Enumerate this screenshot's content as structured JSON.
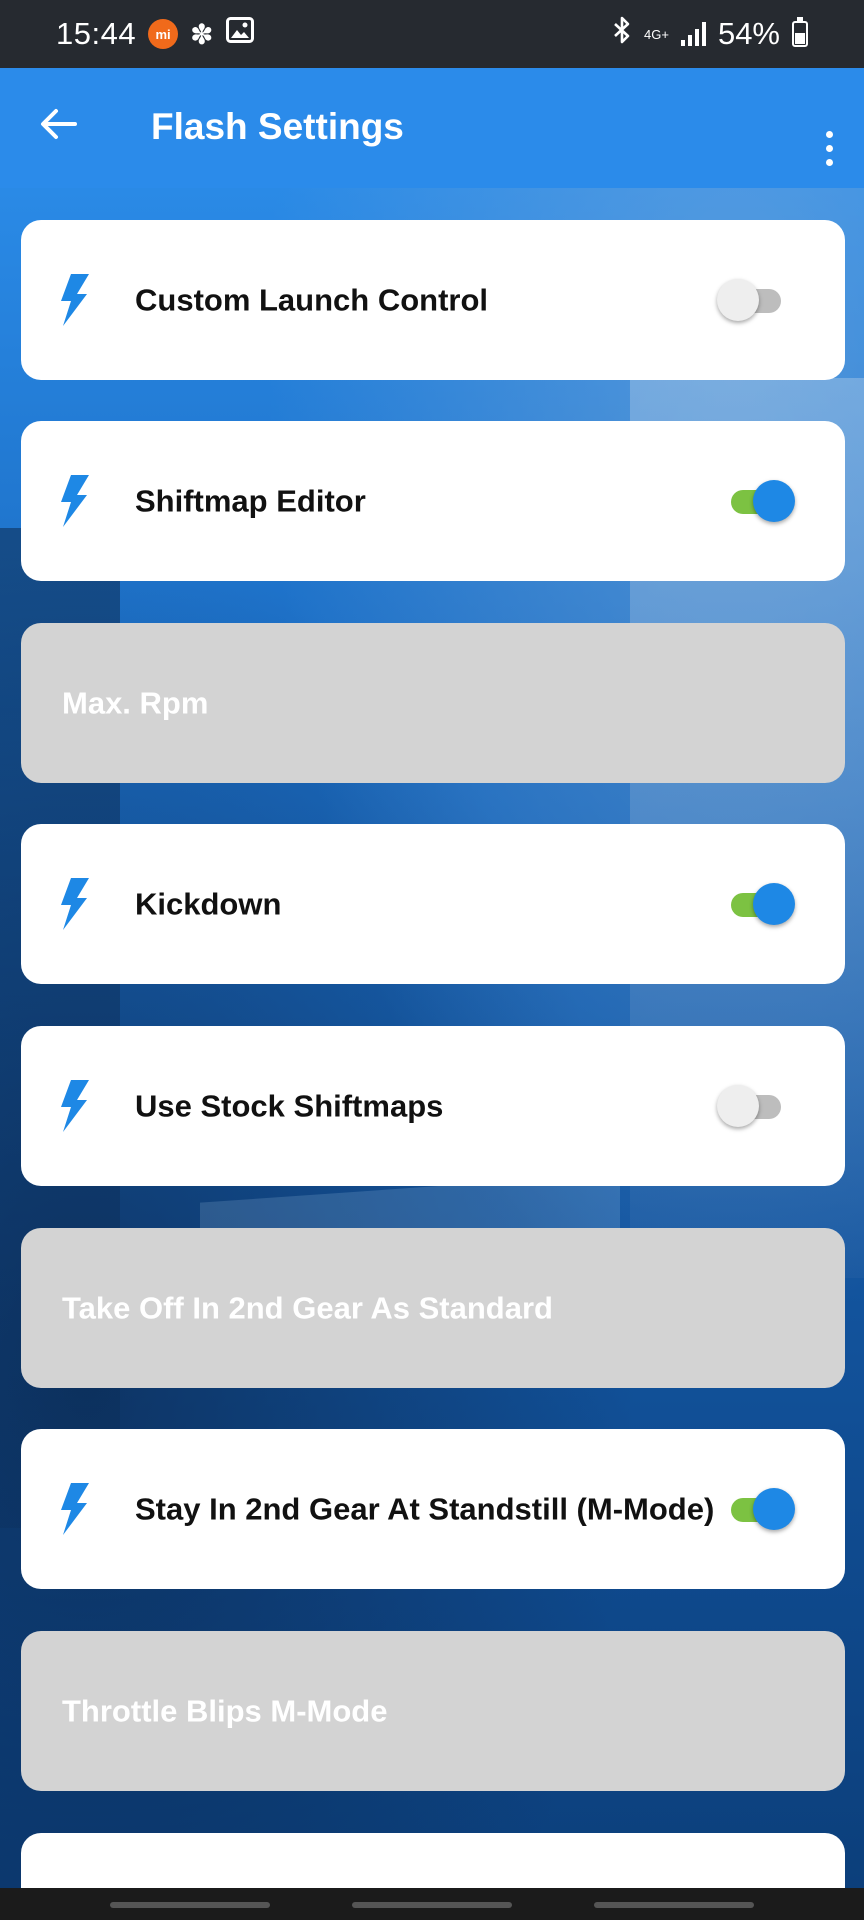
{
  "status_bar": {
    "time": "15:44",
    "mi_badge": "mi",
    "network_type": "4G+",
    "battery_percent": "54%",
    "icons": [
      "mi-notification-icon",
      "fan-icon",
      "image-icon",
      "bluetooth-icon",
      "signal-icon",
      "battery-icon"
    ]
  },
  "app_bar": {
    "title": "Flash Settings",
    "back_icon": "arrow-back-icon",
    "menu_icon": "more-vert-icon"
  },
  "colors": {
    "app_bar": "#2b8bea",
    "accent": "#1e88e5",
    "toggle_track_on": "#7cc242",
    "disabled_card": "#d3d3d3"
  },
  "settings": [
    {
      "label": "Custom Launch Control",
      "enabled": true,
      "on": false
    },
    {
      "label": "Shiftmap Editor",
      "enabled": true,
      "on": true
    },
    {
      "label": "Max. Rpm",
      "enabled": false
    },
    {
      "label": "Kickdown",
      "enabled": true,
      "on": true
    },
    {
      "label": "Use Stock Shiftmaps",
      "enabled": true,
      "on": false
    },
    {
      "label": "Take Off In 2nd Gear As Standard",
      "enabled": false
    },
    {
      "label": "Stay In 2nd Gear At Standstill (M-Mode)",
      "enabled": true,
      "on": true
    },
    {
      "label": "Throttle Blips M-Mode",
      "enabled": false
    }
  ]
}
